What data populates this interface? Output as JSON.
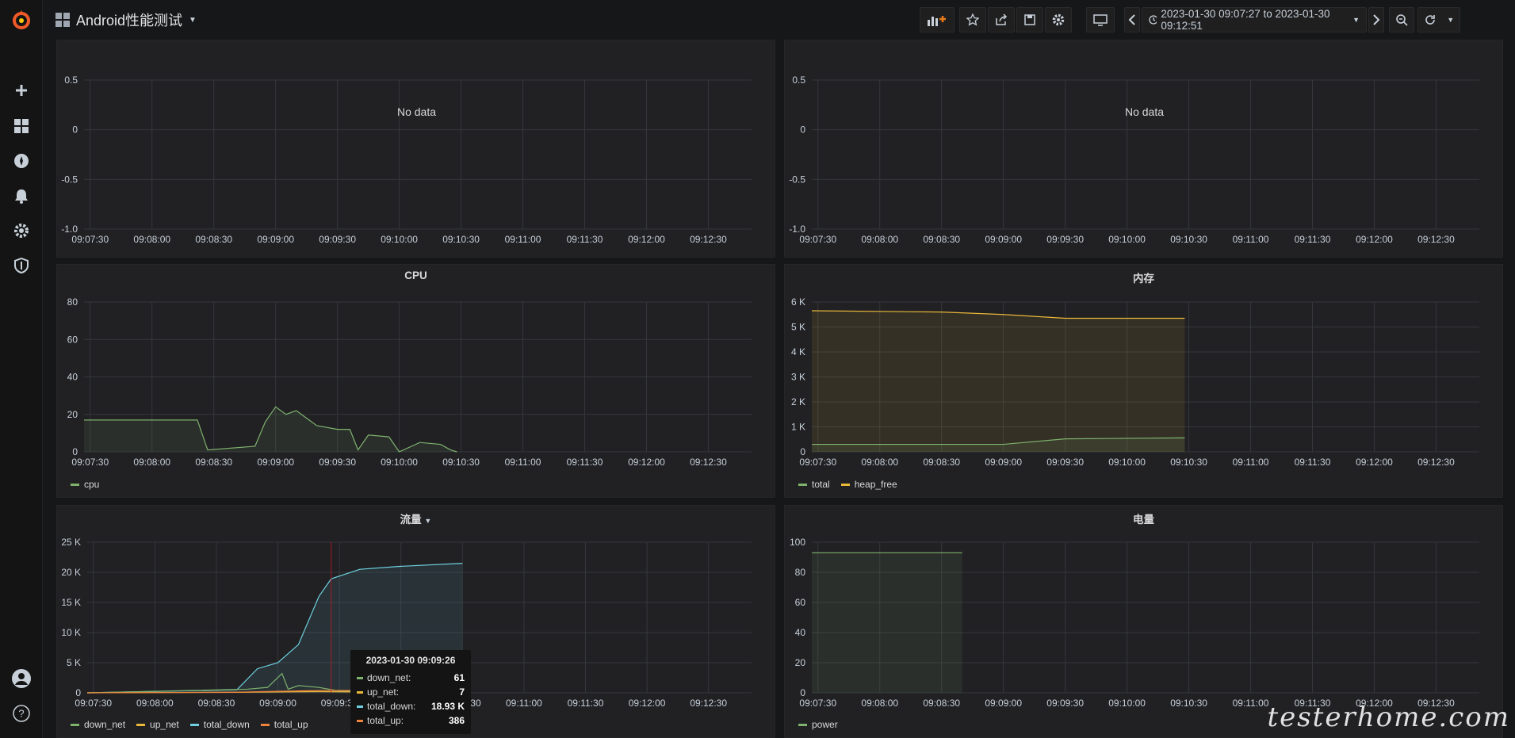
{
  "app": {
    "title": "Android性能测试"
  },
  "toolbar": {
    "time_range": "2023-01-30 09:07:27 to 2023-01-30 09:12:51",
    "icons": [
      "add-panel-icon",
      "star-icon",
      "share-icon",
      "save-icon",
      "settings-icon",
      "tv-mode-icon",
      "chevron-left-icon",
      "clock-icon",
      "chevron-right-icon",
      "zoom-out-icon",
      "refresh-icon",
      "caret-down-icon"
    ]
  },
  "sidebar": {
    "icons": [
      "grafana-logo-icon",
      "plus-icon",
      "dashboards-icon",
      "explore-icon",
      "alert-bell-icon",
      "gear-icon",
      "shield-icon",
      "user-avatar-icon",
      "help-icon"
    ]
  },
  "x_ticks": [
    "09:07:30",
    "09:08:00",
    "09:08:30",
    "09:09:00",
    "09:09:30",
    "09:10:00",
    "09:10:30",
    "09:11:00",
    "09:11:30",
    "09:12:00",
    "09:12:30"
  ],
  "panels": {
    "top_left": {
      "title": "",
      "no_data": "No data",
      "y_ticks": [
        "0.5",
        "0",
        "-0.5",
        "-1.0"
      ]
    },
    "top_right": {
      "title": "",
      "no_data": "No data",
      "y_ticks": [
        "0.5",
        "0",
        "-0.5",
        "-1.0"
      ]
    },
    "cpu": {
      "title": "CPU",
      "y_ticks": [
        "80",
        "60",
        "40",
        "20",
        "0"
      ],
      "legend": [
        "cpu"
      ]
    },
    "memory": {
      "title": "内存",
      "y_ticks": [
        "6 K",
        "5 K",
        "4 K",
        "3 K",
        "2 K",
        "1 K",
        "0"
      ],
      "legend": [
        "total",
        "heap_free"
      ]
    },
    "traffic": {
      "title": "流量",
      "y_ticks": [
        "25 K",
        "20 K",
        "15 K",
        "10 K",
        "5 K",
        "0"
      ],
      "legend": [
        "down_net",
        "up_net",
        "total_down",
        "total_up"
      ]
    },
    "power": {
      "title": "电量",
      "y_ticks": [
        "100",
        "80",
        "60",
        "40",
        "20",
        "0"
      ],
      "legend": [
        "power"
      ]
    }
  },
  "tooltip": {
    "time": "2023-01-30 09:09:26",
    "rows": [
      {
        "name": "down_net:",
        "value": "61",
        "color": "#7eb26d"
      },
      {
        "name": "up_net:",
        "value": "7",
        "color": "#eab839"
      },
      {
        "name": "total_down:",
        "value": "18.93 K",
        "color": "#6ed0e0"
      },
      {
        "name": "total_up:",
        "value": "386",
        "color": "#ef843c"
      }
    ]
  },
  "colors": {
    "green": "#7eb26d",
    "yellow": "#eab839",
    "cyan": "#6ed0e0",
    "orange": "#ef843c"
  },
  "watermark": "testerhome.com",
  "chart_data": [
    {
      "type": "line",
      "panel": "cpu",
      "series": [
        {
          "name": "cpu",
          "x": [
            "09:07:27",
            "09:08:00",
            "09:08:22",
            "09:08:27",
            "09:08:50",
            "09:08:55",
            "09:09:00",
            "09:09:05",
            "09:09:10",
            "09:09:15",
            "09:09:20",
            "09:09:30",
            "09:09:36",
            "09:09:40",
            "09:09:45",
            "09:09:55",
            "09:10:00",
            "09:10:10",
            "09:10:20",
            "09:10:25",
            "09:10:28"
          ],
          "values": [
            17,
            17,
            17,
            1,
            3,
            16,
            24,
            20,
            22,
            18,
            14,
            12,
            12,
            1,
            9,
            8,
            0,
            5,
            4,
            1,
            0
          ]
        }
      ],
      "ylim": [
        0,
        80
      ]
    },
    {
      "type": "area",
      "panel": "memory",
      "series": [
        {
          "name": "total",
          "x": [
            "09:07:27",
            "09:09:00",
            "09:09:30",
            "09:10:28"
          ],
          "values": [
            300,
            300,
            520,
            560
          ]
        },
        {
          "name": "heap_free",
          "x": [
            "09:07:27",
            "09:08:30",
            "09:09:00",
            "09:09:30",
            "09:10:28"
          ],
          "values": [
            5650,
            5600,
            5500,
            5350,
            5350
          ]
        }
      ],
      "ylim": [
        0,
        6000
      ]
    },
    {
      "type": "area",
      "panel": "traffic",
      "series": [
        {
          "name": "total_down",
          "x": [
            "09:07:27",
            "09:08:40",
            "09:08:50",
            "09:09:00",
            "09:09:10",
            "09:09:20",
            "09:09:26",
            "09:09:40",
            "09:10:00",
            "09:10:30"
          ],
          "values": [
            0,
            500,
            4000,
            5000,
            8000,
            16000,
            18930,
            20500,
            21000,
            21500
          ]
        },
        {
          "name": "down_net",
          "values_note": "small spikes"
        },
        {
          "name": "up_net"
        },
        {
          "name": "total_up"
        }
      ],
      "ylim": [
        0,
        25000
      ]
    },
    {
      "type": "area",
      "panel": "power",
      "series": [
        {
          "name": "power",
          "x": [
            "09:07:27",
            "09:08:40"
          ],
          "values": [
            93,
            93
          ]
        }
      ],
      "ylim": [
        0,
        100
      ]
    }
  ]
}
